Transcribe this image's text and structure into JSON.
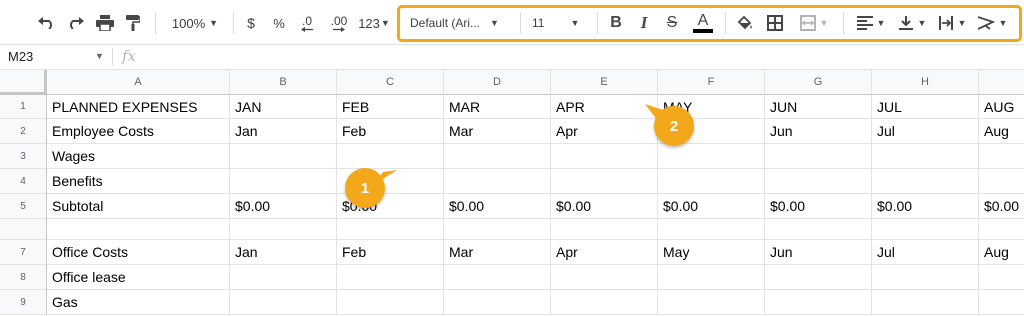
{
  "toolbar": {
    "zoom": "100%",
    "currency": "$",
    "percent": "%",
    "decrease_decimal": ".0",
    "increase_decimal": ".00",
    "number_format": "123",
    "font_family": "Default (Ari...",
    "font_size": "11",
    "bold": "B",
    "italic": "I",
    "strikethrough": "S",
    "text_color": "A",
    "highlight_color": "#f3a81c"
  },
  "formula_bar": {
    "cell_ref": "M23",
    "fx": "fx",
    "value": ""
  },
  "columns": [
    "A",
    "B",
    "C",
    "D",
    "E",
    "F",
    "G",
    "H",
    ""
  ],
  "rows": [
    {
      "num": "1",
      "cells": [
        "PLANNED EXPENSES",
        "JAN",
        "FEB",
        "MAR",
        "APR",
        "MAY",
        "JUN",
        "JUL",
        "AUG"
      ]
    },
    {
      "num": "2",
      "cells": [
        "Employee Costs",
        "Jan",
        "Feb",
        "Mar",
        "Apr",
        "May",
        "Jun",
        "Jul",
        "Aug"
      ]
    },
    {
      "num": "3",
      "cells": [
        "Wages",
        "",
        "",
        "",
        "",
        "",
        "",
        "",
        ""
      ]
    },
    {
      "num": "4",
      "cells": [
        "Benefits",
        "",
        "",
        "",
        "",
        "",
        "",
        "",
        ""
      ]
    },
    {
      "num": "5",
      "cells": [
        "Subtotal",
        "$0.00",
        "$0.00",
        "$0.00",
        "$0.00",
        "$0.00",
        "$0.00",
        "$0.00",
        "$0.00"
      ]
    },
    {
      "num": "",
      "cells": [
        "",
        "",
        "",
        "",
        "",
        "",
        "",
        "",
        ""
      ]
    },
    {
      "num": "7",
      "cells": [
        "Office Costs",
        "Jan",
        "Feb",
        "Mar",
        "Apr",
        "May",
        "Jun",
        "Jul",
        "Aug"
      ]
    },
    {
      "num": "8",
      "cells": [
        "Office lease",
        "",
        "",
        "",
        "",
        "",
        "",
        "",
        ""
      ]
    },
    {
      "num": "9",
      "cells": [
        "Gas",
        "",
        "",
        "",
        "",
        "",
        "",
        "",
        ""
      ]
    }
  ],
  "callouts": [
    {
      "label": "1"
    },
    {
      "label": "2"
    }
  ]
}
